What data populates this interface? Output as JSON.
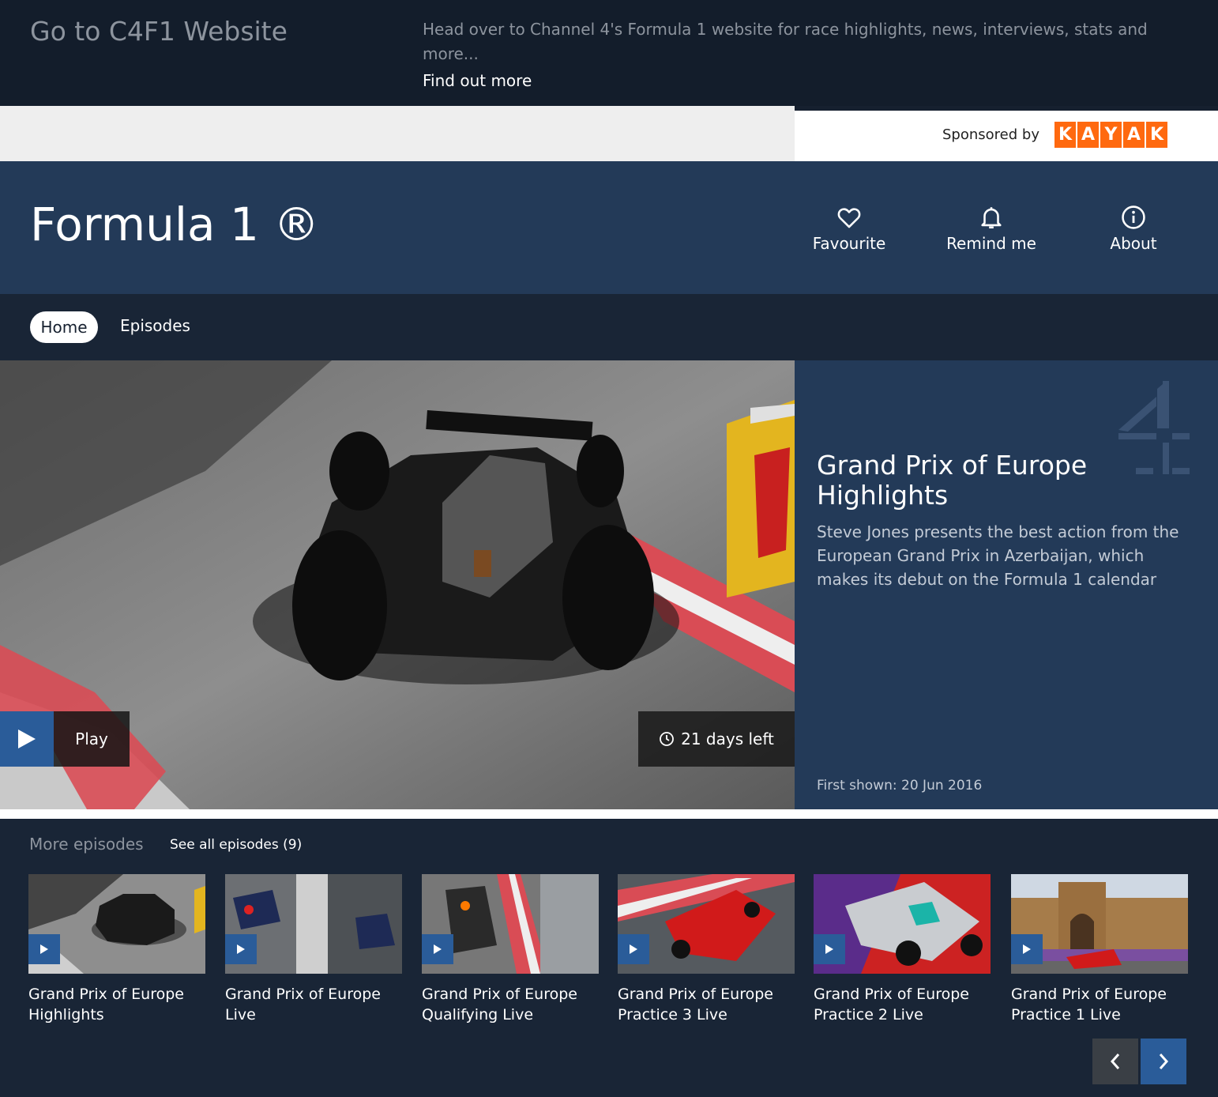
{
  "promo": {
    "title": "Go to C4F1 Website",
    "description": "Head over to Channel 4's Formula 1 website for race highlights, news, interviews, stats and more...",
    "link": "Find out more"
  },
  "sponsor": {
    "label": "Sponsored by",
    "brand_letters": [
      "K",
      "A",
      "Y",
      "A",
      "K"
    ],
    "brand_color": "#ff690f"
  },
  "header": {
    "title": "Formula 1 ®",
    "actions": [
      {
        "label": "Favourite",
        "icon": "heart-icon"
      },
      {
        "label": "Remind me",
        "icon": "bell-icon"
      },
      {
        "label": "About",
        "icon": "info-icon"
      }
    ]
  },
  "nav": {
    "tabs": [
      {
        "label": "Home",
        "active": true
      },
      {
        "label": "Episodes",
        "active": false
      }
    ]
  },
  "hero": {
    "title": "Grand Prix of Europe Highlights",
    "description": "Steve Jones presents the best action from the European Grand Prix in Azerbaijan, which makes its debut on the Formula 1 calendar",
    "first_shown": "First shown: 20 Jun 2016",
    "play_label": "Play",
    "availability": "21 days left"
  },
  "more": {
    "heading": "More episodes",
    "see_all": "See all episodes (9)",
    "episodes": [
      {
        "line1": "Grand Prix of Europe",
        "line2": "Highlights"
      },
      {
        "line1": "Grand Prix of Europe",
        "line2": "Live"
      },
      {
        "line1": "Grand Prix of Europe",
        "line2": "Qualifying Live"
      },
      {
        "line1": "Grand Prix of Europe",
        "line2": "Practice 3 Live"
      },
      {
        "line1": "Grand Prix of Europe",
        "line2": "Practice 2 Live"
      },
      {
        "line1": "Grand Prix of Europe",
        "line2": "Practice 1 Live"
      }
    ]
  },
  "colors": {
    "header_bg": "#233a58",
    "dark_bg": "#131d2b",
    "accent_blue": "#2a5c99"
  }
}
